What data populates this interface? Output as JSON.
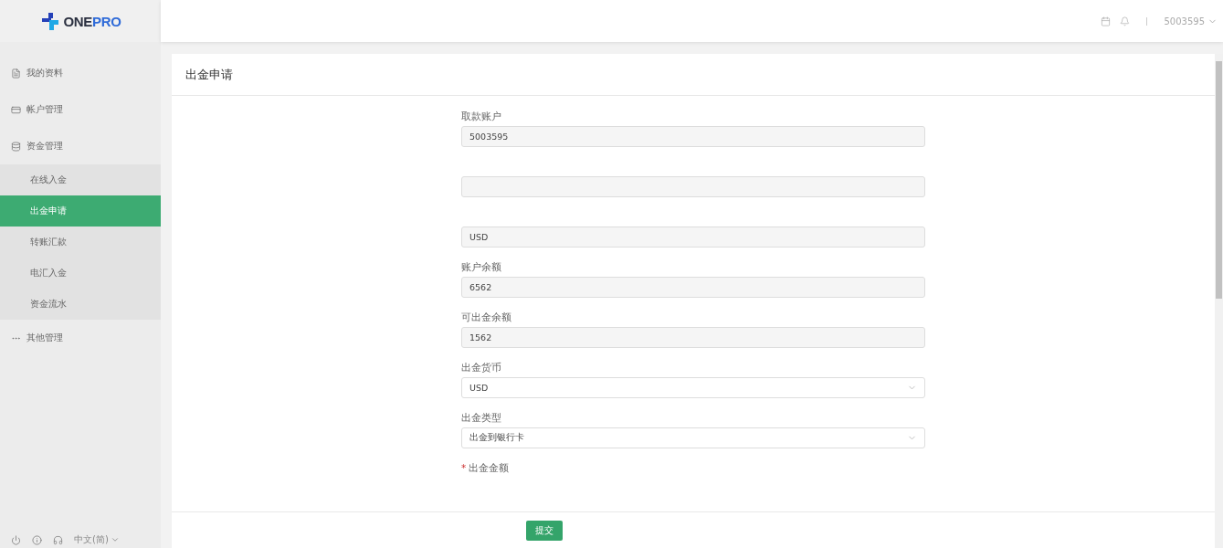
{
  "logo": {
    "word_a": "ONE",
    "word_b": "PRO"
  },
  "header": {
    "account": "5003595"
  },
  "sidebar": {
    "items": [
      {
        "label": "我的资料"
      },
      {
        "label": "帐户管理"
      },
      {
        "label": "资金管理",
        "children": [
          {
            "label": "在线入金",
            "selected": false
          },
          {
            "label": "出金申请",
            "selected": true
          },
          {
            "label": "转账汇款",
            "selected": false
          },
          {
            "label": "电汇入金",
            "selected": false
          },
          {
            "label": "资金流水",
            "selected": false
          }
        ]
      },
      {
        "label": "其他管理"
      }
    ],
    "language": "中文(简)"
  },
  "panel": {
    "title": "出金申请",
    "fields": [
      {
        "label": "取款账户",
        "kind": "readonly",
        "value": "5003595"
      },
      {
        "kind": "readonly"
      },
      {
        "kind": "readonly",
        "value": "USD"
      },
      {
        "label": "账户余额",
        "kind": "readonly",
        "value": "6562"
      },
      {
        "label": "可出金余额",
        "kind": "readonly",
        "value": "1562"
      },
      {
        "label": "出金货币",
        "kind": "select",
        "value": "USD"
      },
      {
        "label": "出金类型",
        "kind": "select",
        "value": "出金到银行卡"
      },
      {
        "label": "出金金额",
        "kind": "label_only",
        "mark": "*"
      }
    ],
    "submit": "提交"
  }
}
